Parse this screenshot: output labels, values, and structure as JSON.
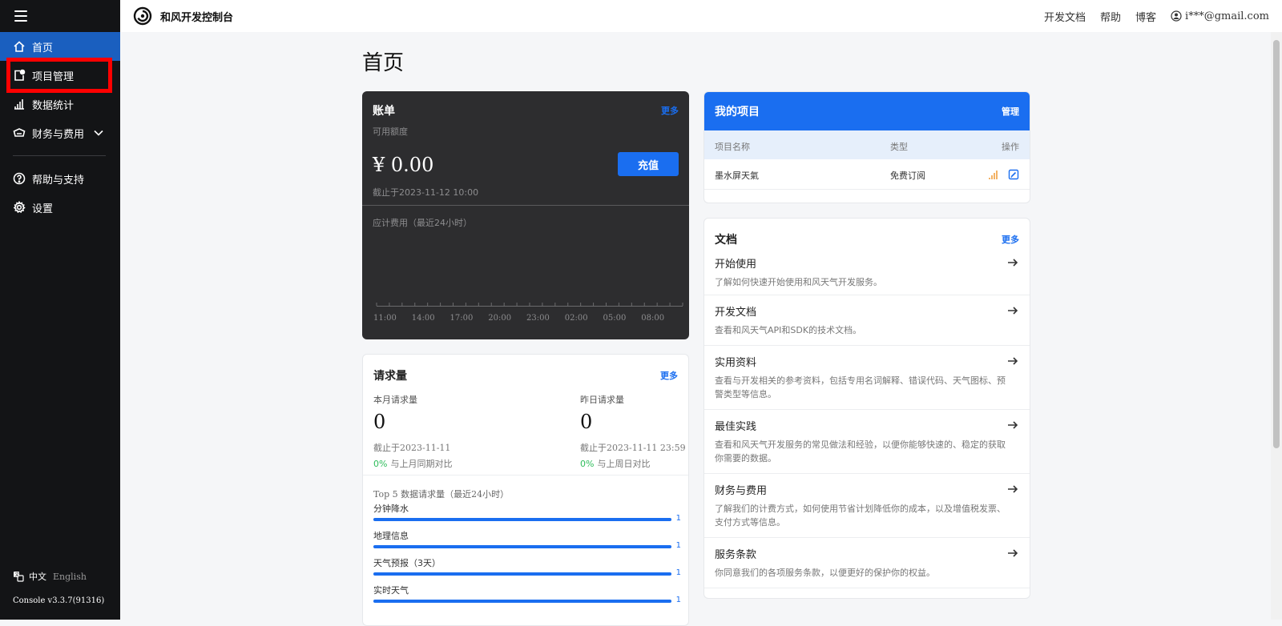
{
  "app": {
    "brand_name": "和风开发控制台"
  },
  "topbar": {
    "links": [
      "开发文档",
      "帮助",
      "博客"
    ],
    "user_email": "i***@gmail.com"
  },
  "sidebar": {
    "items": [
      {
        "label": "首页",
        "icon": "home-icon"
      },
      {
        "label": "项目管理",
        "icon": "project-icon"
      },
      {
        "label": "数据统计",
        "icon": "chart-icon"
      },
      {
        "label": "财务与费用",
        "icon": "wallet-icon"
      },
      {
        "label": "帮助与支持",
        "icon": "help-icon"
      },
      {
        "label": "设置",
        "icon": "gear-icon"
      }
    ],
    "lang_zh": "中文",
    "lang_en": "English",
    "version": "Console v3.3.7(91316)"
  },
  "page": {
    "title": "首页"
  },
  "bill": {
    "title": "账单",
    "more": "更多",
    "available_label": "可用额度",
    "balance": "¥ 0.00",
    "recharge": "充值",
    "as_of": "截止于2023-11-12 10:00",
    "fee_label": "应计费用（最近24小时）",
    "time_labels": [
      "11:00",
      "14:00",
      "17:00",
      "20:00",
      "23:00",
      "02:00",
      "05:00",
      "08:00"
    ]
  },
  "requests": {
    "title": "请求量",
    "more": "更多",
    "month_label": "本月请求量",
    "month_value": "0",
    "month_as_of": "截止于2023-11-11",
    "month_pct": "0%",
    "month_cmp": "与上月同期对比",
    "yday_label": "昨日请求量",
    "yday_value": "0",
    "yday_as_of": "截止于2023-11-11 23:59",
    "yday_pct": "0%",
    "yday_cmp": "与上周日对比",
    "top5_title": "Top 5 数据请求量（最近24小时）",
    "top5": [
      {
        "name": "分钟降水",
        "value": "1",
        "fill": 1.0
      },
      {
        "name": "地理信息",
        "value": "1",
        "fill": 1.0
      },
      {
        "name": "天气预报（3天）",
        "value": "1",
        "fill": 1.0
      },
      {
        "name": "实时天气",
        "value": "1",
        "fill": 1.0
      }
    ]
  },
  "projects": {
    "title": "我的项目",
    "manage": "管理",
    "col_name": "项目名称",
    "col_type": "类型",
    "col_action": "操作",
    "rows": [
      {
        "name": "墨水屏天氣",
        "type": "免费订阅"
      }
    ],
    "accent_orange": "#f0a040"
  },
  "docs": {
    "title": "文档",
    "more": "更多",
    "items": [
      {
        "title": "开始使用",
        "desc": "了解如何快速开始使用和风天气开发服务。"
      },
      {
        "title": "开发文档",
        "desc": "查看和风天气API和SDK的技术文档。"
      },
      {
        "title": "实用资料",
        "desc": "查看与开发相关的参考资料，包括专用名词解释、错误代码、天气图标、预警类型等信息。"
      },
      {
        "title": "最佳实践",
        "desc": "查看和风天气开发服务的常见做法和经验，以便你能够快速的、稳定的获取你需要的数据。"
      },
      {
        "title": "财务与费用",
        "desc": "了解我们的计费方式，如何使用节省计划降低你的成本，以及增值税发票、支付方式等信息。"
      },
      {
        "title": "服务条款",
        "desc": "你同意我们的各项服务条款，以便更好的保护你的权益。"
      }
    ]
  },
  "colors": {
    "primary": "#1a6ef0",
    "sidebar_bg": "#131416",
    "active_item": "#1a5fbf",
    "highlight": "#ff0000",
    "positive": "#2ebd5b"
  }
}
